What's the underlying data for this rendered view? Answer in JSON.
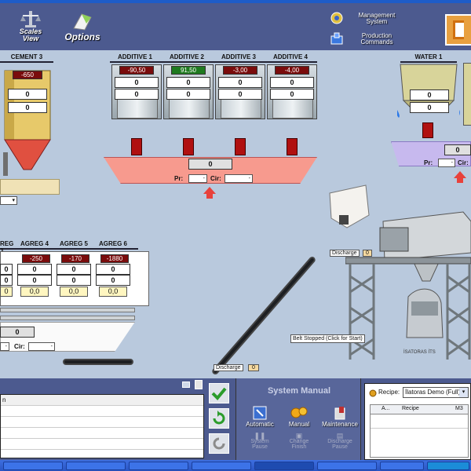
{
  "toolbar": {
    "scales_view_line1": "Scales",
    "scales_view_line2": "View",
    "options": "Options",
    "management_line1": "Management",
    "management_line2": "System",
    "production_line1": "Production",
    "production_line2": "Commands"
  },
  "cement": {
    "title": "CEMENT 3",
    "value": "-650",
    "zero1": "0",
    "zero2": "0"
  },
  "additives": [
    {
      "title": "ADDITIVE 1",
      "value": "-90,50",
      "zero1": "0",
      "zero2": "0"
    },
    {
      "title": "ADDITIVE 2",
      "value": "91,50",
      "zero1": "0",
      "zero2": "0"
    },
    {
      "title": "ADDITIVE 3",
      "value": "-3,00",
      "zero1": "0",
      "zero2": "0"
    },
    {
      "title": "ADDITIVE 4",
      "value": "-4,00",
      "zero1": "0",
      "zero2": "0"
    }
  ],
  "additive_tray": {
    "total": "0",
    "pr_label": "Pr:",
    "cir_label": "Cir:"
  },
  "water": {
    "title": "WATER 1",
    "zero1": "0",
    "zero2": "0",
    "total": "0",
    "pr_label": "Pr:",
    "cir_label": "Cir:"
  },
  "agregs": [
    {
      "title": "REG 3",
      "value": "",
      "zero1": "0",
      "zero2": "0",
      "yellow": "0"
    },
    {
      "title": "AGREG 4",
      "value": "-250",
      "zero1": "0",
      "zero2": "0",
      "yellow": "0,0"
    },
    {
      "title": "AGREG 5",
      "value": "-170",
      "zero1": "0",
      "zero2": "0",
      "yellow": "0,0"
    },
    {
      "title": "AGREG 6",
      "value": "-1880",
      "zero1": "0",
      "zero2": "0",
      "yellow": "0,0"
    }
  ],
  "agreg_tray": {
    "total": "0",
    "cir_label": "Cir:"
  },
  "mixer": {
    "discharge_label_top": "Discharge",
    "discharge_value_top": "0",
    "belt_status": "Belt Stopped (Click for Start)",
    "discharge_label_bottom": "Discharge",
    "discharge_value_bottom": "0",
    "truck_label": "İSATORAS İTS"
  },
  "system_manual": {
    "title": "System Manual",
    "automatic": "Automatic",
    "manual": "Manual",
    "maintenance": "Maintenance",
    "system_pause_line1": "System",
    "system_pause_line2": "Pause",
    "change_finish_line1": "Change",
    "change_finish_line2": "Finish",
    "discharge_pause_line1": "Discharge",
    "discharge_pause_line2": "Pause"
  },
  "recipe": {
    "label": "Recipe:",
    "selected": "İlatoras Demo (Full)",
    "col_a": "A...",
    "col_recipe": "Recipe",
    "col_m3": "M3"
  },
  "log_panel": {
    "header": "n"
  },
  "colors": {
    "panel": "#4c5a8f",
    "background": "#b9c9dd",
    "valve": "#b01010",
    "tray": "#f79a8e"
  }
}
